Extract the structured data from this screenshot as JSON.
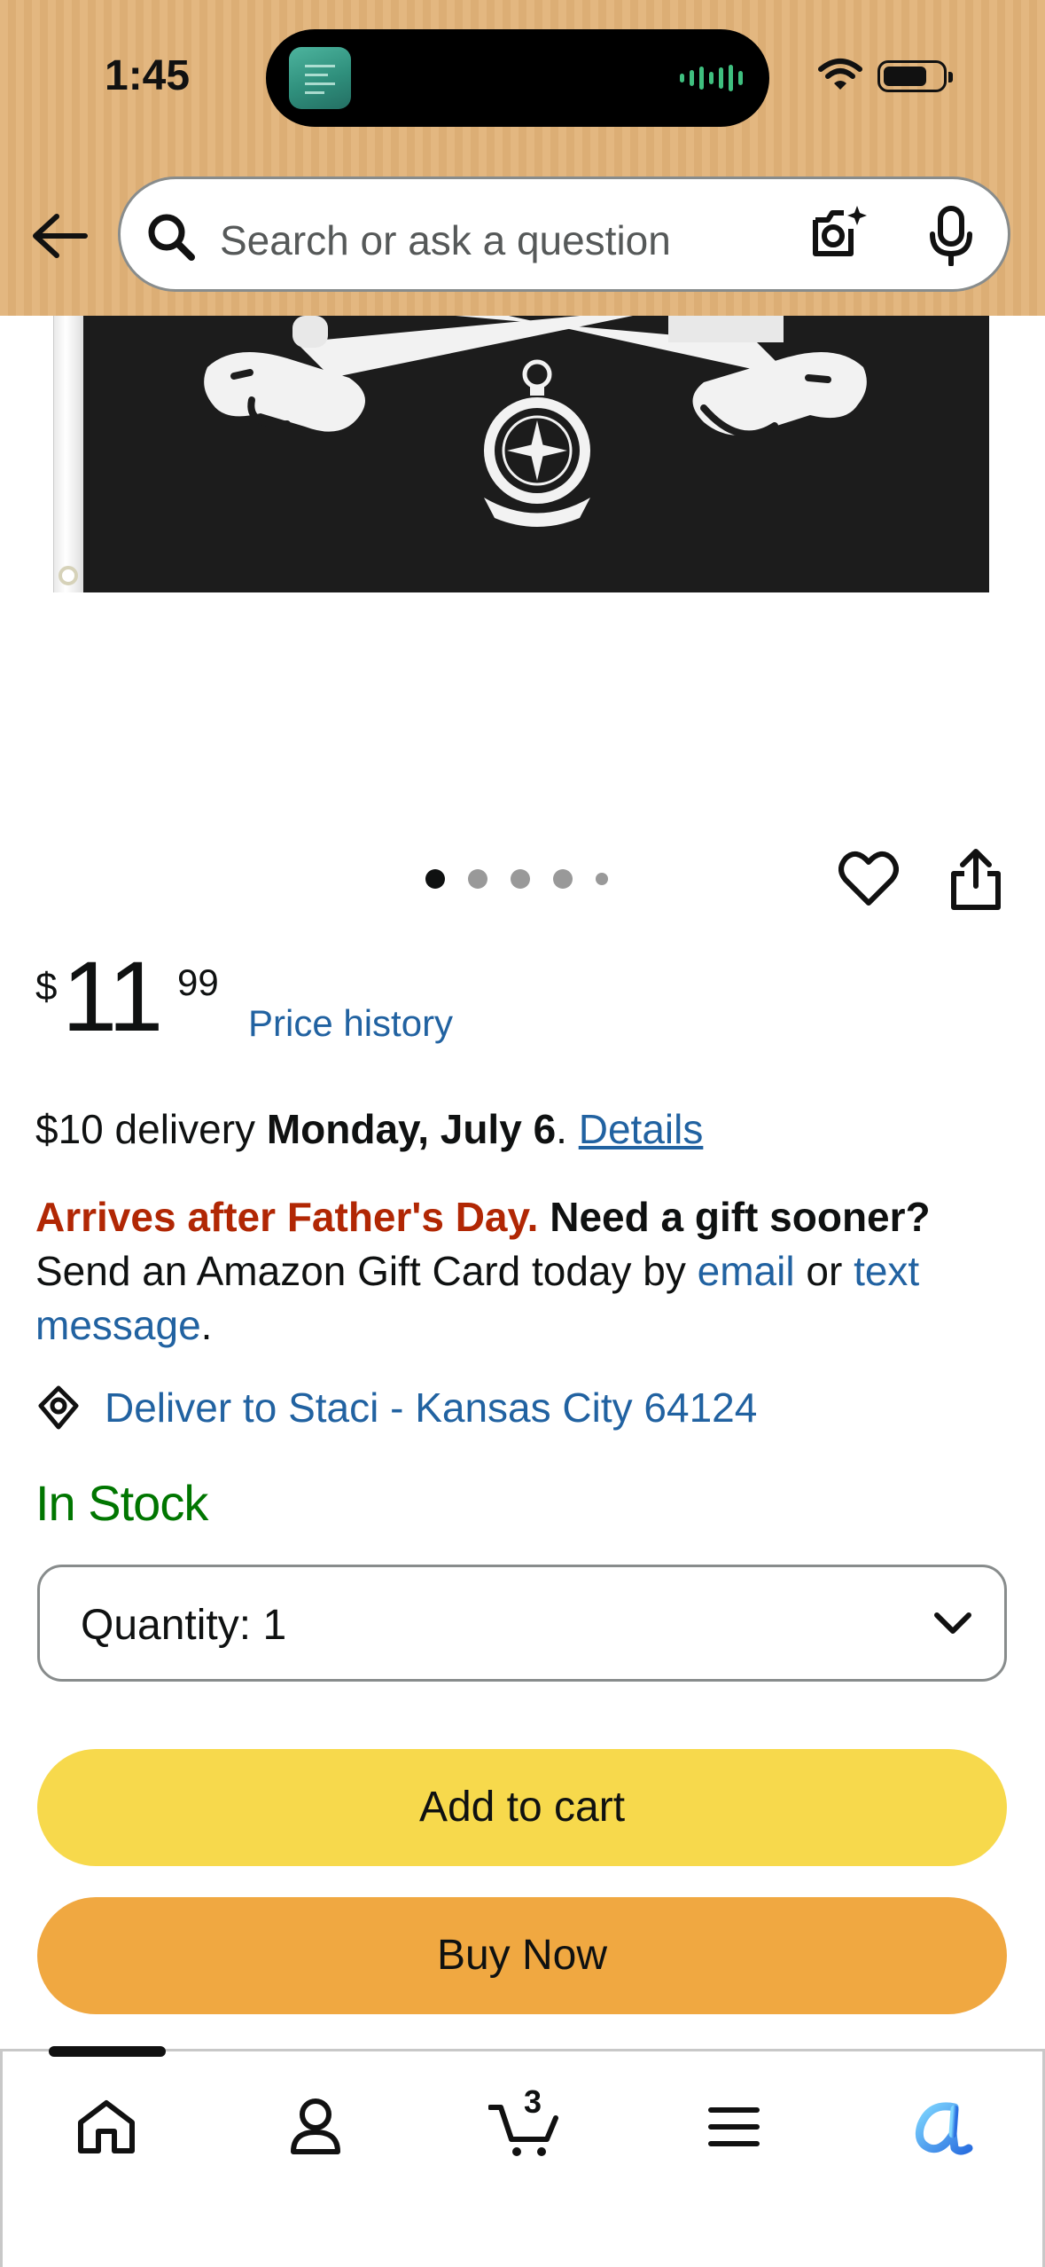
{
  "status_bar": {
    "time": "1:45"
  },
  "search": {
    "placeholder": "Search or ask a question"
  },
  "product": {
    "image_count": 5,
    "active_image_index": 0
  },
  "price": {
    "symbol": "$",
    "whole": "11",
    "fraction": "99",
    "history_link": "Price history"
  },
  "delivery": {
    "prefix": "$10 delivery ",
    "date": "Monday, July 6",
    "period": ". ",
    "details_link": "Details"
  },
  "arrival": {
    "warning": "Arrives after Father's Day.",
    "gift_prompt": "Need a gift sooner?",
    "text": "Send an Amazon Gift Card today by",
    "email_link": "email",
    "or": "or",
    "text_link": "text message",
    "end": "."
  },
  "deliver_to": "Deliver to Staci - Kansas City 64124",
  "stock_status": "In Stock",
  "quantity": {
    "label": "Quantity:",
    "value": "1"
  },
  "buttons": {
    "add_to_cart": "Add to cart",
    "buy_now": "Buy Now"
  },
  "tabbar": {
    "cart_count": "3",
    "items": [
      "home-icon",
      "account-icon",
      "cart-icon",
      "menu-icon",
      "rufus-icon"
    ]
  },
  "colors": {
    "header": "#e3b780",
    "link": "#2162a1",
    "warning": "#b12704",
    "in_stock": "#007600",
    "add_to_cart": "#f7d94c",
    "buy_now": "#f0a841"
  }
}
